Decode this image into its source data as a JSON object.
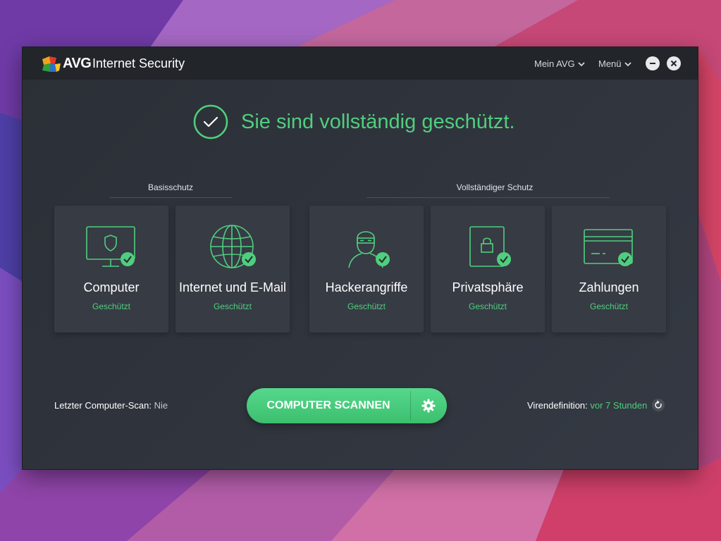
{
  "app": {
    "logo_text": "AVG",
    "product_name": "Internet Security"
  },
  "titlebar": {
    "menu_my_avg": "Mein AVG",
    "menu_main": "Menü"
  },
  "status": {
    "message": "Sie sind vollständig geschützt."
  },
  "sections": {
    "basic": "Basisschutz",
    "full": "Vollständiger Schutz"
  },
  "cards": [
    {
      "title": "Computer",
      "status": "Geschützt",
      "icon": "monitor-shield-icon"
    },
    {
      "title": "Internet und E-Mail",
      "status": "Geschützt",
      "icon": "globe-icon"
    },
    {
      "title": "Hackerangriffe",
      "status": "Geschützt",
      "icon": "hacker-icon"
    },
    {
      "title": "Privatsphäre",
      "status": "Geschützt",
      "icon": "lock-icon"
    },
    {
      "title": "Zahlungen",
      "status": "Geschützt",
      "icon": "credit-card-icon"
    }
  ],
  "footer": {
    "last_scan_label": "Letzter Computer-Scan:",
    "last_scan_value": "Nie",
    "scan_button": "COMPUTER SCANNEN",
    "virus_def_label": "Virendefinition:",
    "virus_def_value": "vor 7 Stunden"
  },
  "colors": {
    "accent_green": "#4fcf7e",
    "window_bg": "#2e323a",
    "card_bg": "#373b44"
  }
}
